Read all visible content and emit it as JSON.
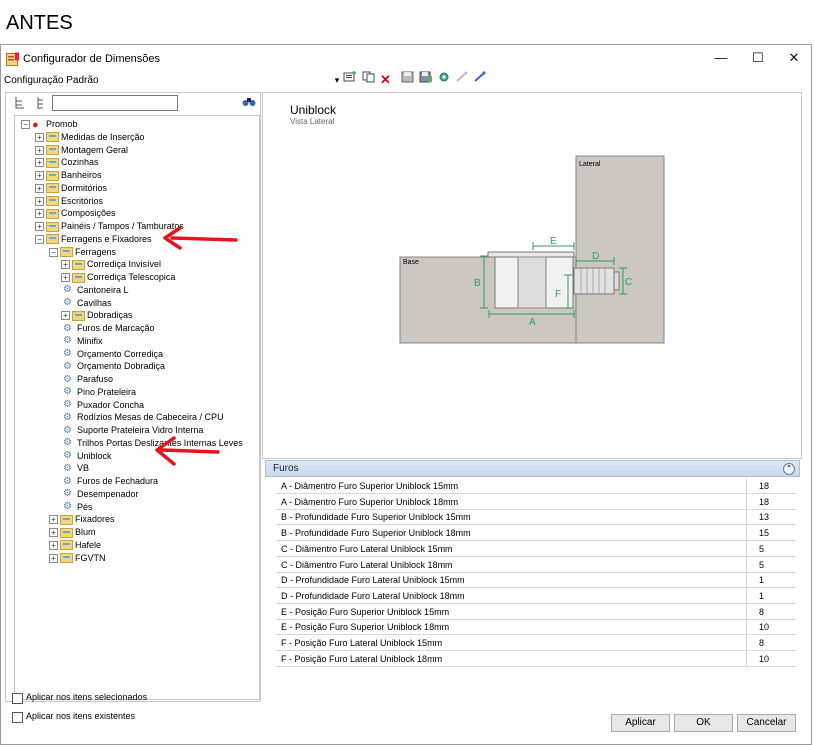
{
  "caption": "ANTES",
  "window": {
    "title": "Configurador de Dimensões",
    "min_glyph": "—",
    "max_glyph": "☐",
    "close_glyph": "✕"
  },
  "config_label": "Configuração Padrão",
  "toolbar": {
    "dropdown_glyph": "▾",
    "delete_glyph": "✕"
  },
  "search": {
    "value": "",
    "placeholder": ""
  },
  "tree": [
    {
      "label": "Promob",
      "level": 0,
      "type": "root",
      "expanded": true
    },
    {
      "label": "Medidas de Inserção",
      "level": 1,
      "type": "folder",
      "expanded": false
    },
    {
      "label": "Montagem Geral",
      "level": 1,
      "type": "folder",
      "expanded": false
    },
    {
      "label": "Cozinhas",
      "level": 1,
      "type": "folder",
      "expanded": false
    },
    {
      "label": "Banheiros",
      "level": 1,
      "type": "folder",
      "expanded": false
    },
    {
      "label": "Dormitórios",
      "level": 1,
      "type": "folder",
      "expanded": false
    },
    {
      "label": "Escritórios",
      "level": 1,
      "type": "folder",
      "expanded": false
    },
    {
      "label": "Composições",
      "level": 1,
      "type": "folder",
      "expanded": false
    },
    {
      "label": "Painéis / Tampos / Tamburatos",
      "level": 1,
      "type": "folder",
      "expanded": false
    },
    {
      "label": "Ferragens e Fixadores",
      "level": 1,
      "type": "folder",
      "expanded": true
    },
    {
      "label": "Ferragens",
      "level": 2,
      "type": "folder",
      "expanded": true
    },
    {
      "label": "Corrediça Invisível",
      "level": 3,
      "type": "folder",
      "expanded": false
    },
    {
      "label": "Corrediça Telescopica",
      "level": 3,
      "type": "folder",
      "expanded": false
    },
    {
      "label": "Cantoneira L",
      "level": 3,
      "type": "leaf"
    },
    {
      "label": "Cavilhas",
      "level": 3,
      "type": "leaf"
    },
    {
      "label": "Dobradiças",
      "level": 3,
      "type": "folder",
      "expanded": false
    },
    {
      "label": "Furos de Marcação",
      "level": 3,
      "type": "leaf"
    },
    {
      "label": "Minifix",
      "level": 3,
      "type": "leaf"
    },
    {
      "label": "Orçamento Corrediça",
      "level": 3,
      "type": "leaf"
    },
    {
      "label": "Orçamento Dobradiça",
      "level": 3,
      "type": "leaf"
    },
    {
      "label": "Parafuso",
      "level": 3,
      "type": "leaf"
    },
    {
      "label": "Pino Prateleira",
      "level": 3,
      "type": "leaf"
    },
    {
      "label": "Puxador Concha",
      "level": 3,
      "type": "leaf"
    },
    {
      "label": "Rodízios Mesas de Cabeceira / CPU",
      "level": 3,
      "type": "leaf"
    },
    {
      "label": "Suporte Prateleira Vidro Interna",
      "level": 3,
      "type": "leaf"
    },
    {
      "label": "Trilhos Portas Deslizantes Internas Leves",
      "level": 3,
      "type": "leaf"
    },
    {
      "label": "Uniblock",
      "level": 3,
      "type": "leaf"
    },
    {
      "label": "VB",
      "level": 3,
      "type": "leaf"
    },
    {
      "label": "Furos de Fechadura",
      "level": 3,
      "type": "leaf"
    },
    {
      "label": "Desempenador",
      "level": 3,
      "type": "leaf"
    },
    {
      "label": "Pés",
      "level": 3,
      "type": "leaf"
    },
    {
      "label": "Fixadores",
      "level": 2,
      "type": "folder",
      "expanded": false
    },
    {
      "label": "Blum",
      "level": 2,
      "type": "folder",
      "expanded": false
    },
    {
      "label": "Hafele",
      "level": 2,
      "type": "folder",
      "expanded": false
    },
    {
      "label": "FGVTN",
      "level": 2,
      "type": "folder",
      "expanded": false
    }
  ],
  "preview": {
    "title": "Uniblock",
    "subtitle": "Vista Lateral",
    "label_lateral": "Lateral",
    "label_base": "Base",
    "dims": [
      "A",
      "B",
      "C",
      "D",
      "E",
      "F"
    ]
  },
  "props": {
    "group": "Furos",
    "collapse_glyph": "⌃",
    "rows": [
      {
        "name": "A - Diâmentro Furo Superior Uniblock 15mm",
        "value": "18"
      },
      {
        "name": "A - Diâmentro Furo Superior Uniblock 18mm",
        "value": "18"
      },
      {
        "name": "B - Profundidade Furo Superior Uniblock 15mm",
        "value": "13"
      },
      {
        "name": "B - Profundidade Furo Superior Uniblock 18mm",
        "value": "15"
      },
      {
        "name": "C - Diâmentro Furo Lateral Uniblock 15mm",
        "value": "5"
      },
      {
        "name": "C - Diâmentro Furo Lateral Uniblock 18mm",
        "value": "5"
      },
      {
        "name": "D - Profundidade Furo Lateral Uniblock 15mm",
        "value": "1"
      },
      {
        "name": "D - Profundidade Furo Lateral Uniblock 18mm",
        "value": "1"
      },
      {
        "name": "E - Posição Furo Superior Uniblock 15mm",
        "value": "8"
      },
      {
        "name": "E - Posição Furo Superior Uniblock 18mm",
        "value": "10"
      },
      {
        "name": "F - Posição Furo Lateral Uniblock 15mm",
        "value": "8"
      },
      {
        "name": "F - Posição Furo Lateral Uniblock 18mm",
        "value": "10"
      }
    ]
  },
  "checks": {
    "selected": "Aplicar nos itens selecionados",
    "existing": "Aplicar nos itens existentes"
  },
  "buttons": {
    "apply": "Aplicar",
    "ok": "OK",
    "cancel": "Cancelar"
  },
  "colors": {
    "annotation_arrow": "#e8141c",
    "dimension_green": "#2e9e5a",
    "panel_gray": "#ccc7c1"
  }
}
